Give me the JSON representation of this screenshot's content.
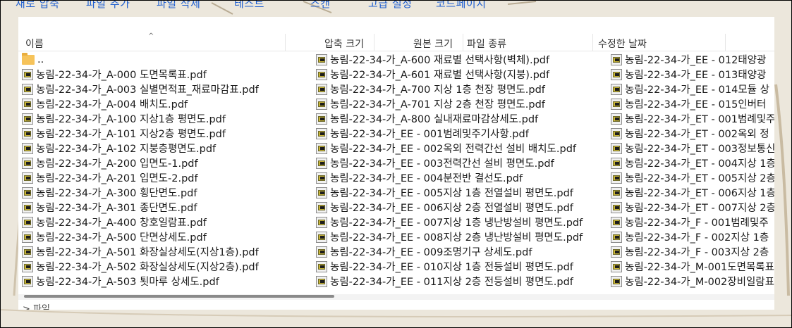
{
  "toolbar": {
    "items": [
      "새로 압축",
      "파일 추가",
      "파일 삭제",
      "테스트",
      "스캔",
      "고급 설정",
      "코드페이지"
    ]
  },
  "columns": {
    "name": "이름",
    "compressed": "압축 크기",
    "original": "원본 크기",
    "type": "파일 종류",
    "modified": "수정한 날짜"
  },
  "files": {
    "col1": [
      "..",
      "농림-22-34-가_A-000 도면목록표.pdf",
      "농림-22-34-가_A-003 실별면적표_재료마감표.pdf",
      "농림-22-34-가_A-004 배치도.pdf",
      "농림-22-34-가_A-100 지상1층 평면도.pdf",
      "농림-22-34-가_A-101 지상2층 평면도.pdf",
      "농림-22-34-가_A-102 지붕층평면도.pdf",
      "농림-22-34-가_A-200 입면도-1.pdf",
      "농림-22-34-가_A-201 입면도-2.pdf",
      "농림-22-34-가_A-300 횡단면도.pdf",
      "농림-22-34-가_A-301 종단면도.pdf",
      "농림-22-34-가_A-400 창호일람표.pdf",
      "농림-22-34-가_A-500 단면상세도.pdf",
      "농림-22-34-가_A-501 화장실상세도(지상1층).pdf",
      "농림-22-34-가_A-502 화장실상세도(지상2층).pdf",
      "농림-22-34-가_A-503 툇마루 상세도.pdf"
    ],
    "col2": [
      "농림-22-34-가_A-600 재료별 선택사항(벽체).pdf",
      "농림-22-34-가_A-601 재료별 선택사항(지붕).pdf",
      "농림-22-34-가_A-700 지상 1층 천장 평면도.pdf",
      "농림-22-34-가_A-701 지상 2층 천장 평면도.pdf",
      "농림-22-34-가_A-800 실내재료마감상세도.pdf",
      "농림-22-34-가_EE - 001범례및주기사항.pdf",
      "농림-22-34-가_EE - 002옥외 전력간선 설비 배치도.pdf",
      "농림-22-34-가_EE - 003전력간선 설비 평면도.pdf",
      "농림-22-34-가_EE - 004분전반 결선도.pdf",
      "농림-22-34-가_EE - 005지상 1층 전열설비 평면도.pdf",
      "농림-22-34-가_EE - 006지상 2층 전열설비 평면도.pdf",
      "농림-22-34-가_EE - 007지상 1층 냉난방설비 평면도.pdf",
      "농림-22-34-가_EE - 008지상 2층 냉난방설비 평면도.pdf",
      "농림-22-34-가_EE - 009조명기구 상세도.pdf",
      "농림-22-34-가_EE - 010지상 1층 전등설비 평면도.pdf",
      "농림-22-34-가_EE - 011지상 2층 전등설비 평면도.pdf"
    ],
    "col3": [
      "농림-22-34-가_EE - 012태양광",
      "농림-22-34-가_EE - 013태양광",
      "농림-22-34-가_EE - 014모듈 상",
      "농림-22-34-가_EE - 015인버터",
      "농림-22-34-가_ET - 001범례및주",
      "농림-22-34-가_ET - 002옥외 정",
      "농림-22-34-가_ET - 003정보통신",
      "농림-22-34-가_ET - 004지상 1층",
      "농림-22-34-가_ET - 005지상 2층",
      "농림-22-34-가_ET - 006지상 1층",
      "농림-22-34-가_ET - 007지상 2층",
      "농림-22-34-가_F - 001범례및주",
      "농림-22-34-가_F - 002지상 1층",
      "농림-22-34-가_F - 003지상 2층",
      "농림-22-34-가_M-001도면목록표",
      "농림-22-34-가_M-002장비일람표"
    ]
  },
  "status": {
    "label": "> 파일"
  }
}
